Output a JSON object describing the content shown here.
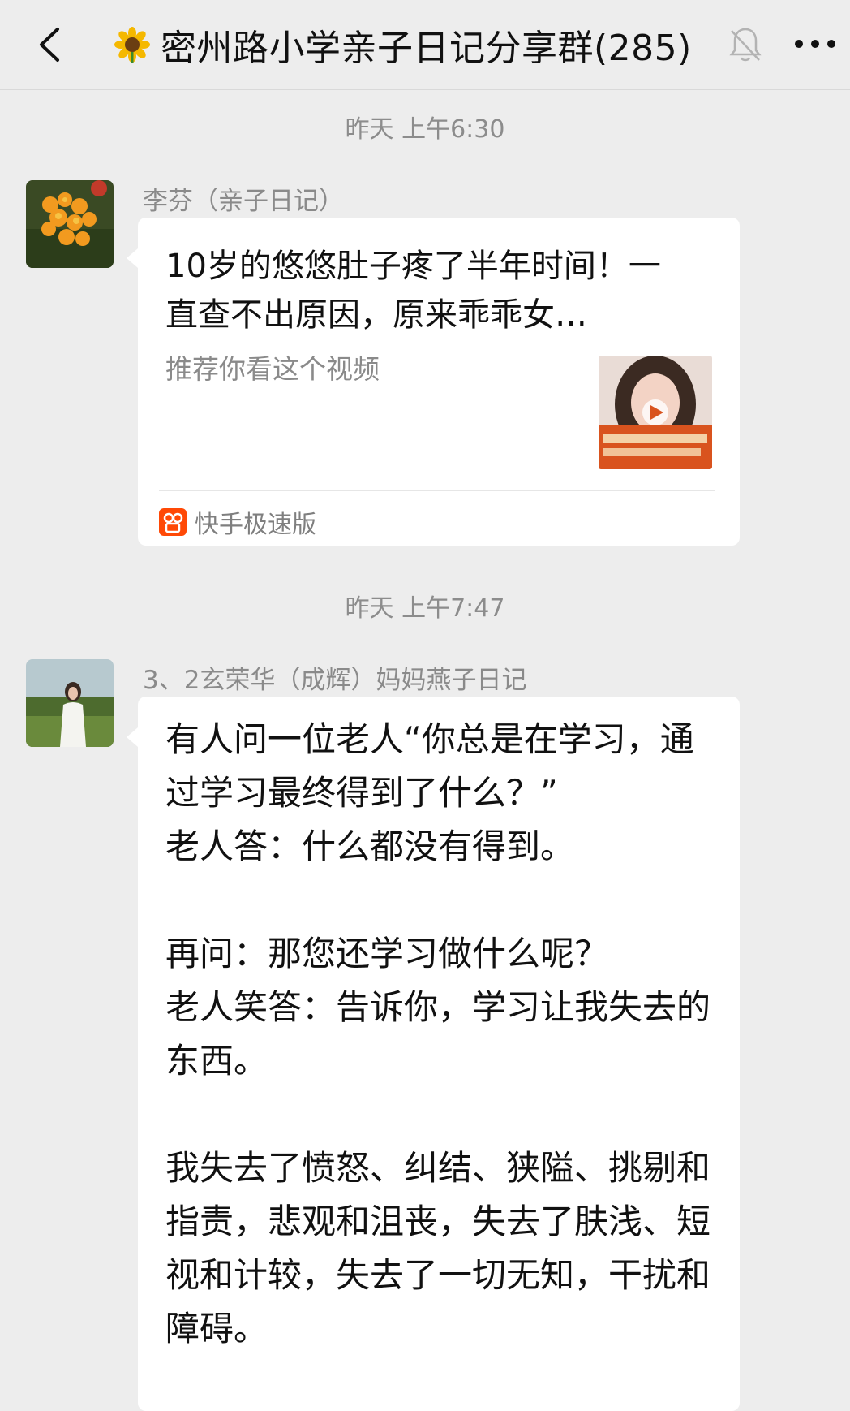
{
  "header": {
    "title": "密州路小学亲子日记分享群(285)",
    "title_emoji": "sunflower-icon",
    "back_icon": "chevron-left-icon",
    "mute_icon": "bell-off-icon",
    "more_icon": "more-dots-icon"
  },
  "messages": [
    {
      "time": "昨天 上午6:30",
      "sender": "李芬（亲子日记）",
      "type": "video-card",
      "card": {
        "title": "10岁的悠悠肚子疼了半年时间！一直查不出原因，原来乖乖女…",
        "description": "推荐你看这个视频",
        "source": "快手极速版"
      }
    },
    {
      "time": "昨天 上午7:47",
      "sender": "3、2玄荣华（成辉）妈妈燕子日记",
      "type": "text",
      "text": "有人问一位老人“你总是在学习，通过学习最终得到了什么？”\n老人答：什么都没有得到。\n\n再问：那您还学习做什么呢？\n老人笑答：告诉你，学习让我失去的东西。\n\n我失去了愤怒、纠结、狭隘、挑剔和指责，悲观和沮丧，失去了肤浅、短视和计较，失去了一切无知，干扰和障碍。"
    }
  ],
  "colors": {
    "background": "#ededed",
    "bubble": "#ffffff",
    "text_primary": "#111111",
    "text_secondary": "#8a8a8a"
  }
}
